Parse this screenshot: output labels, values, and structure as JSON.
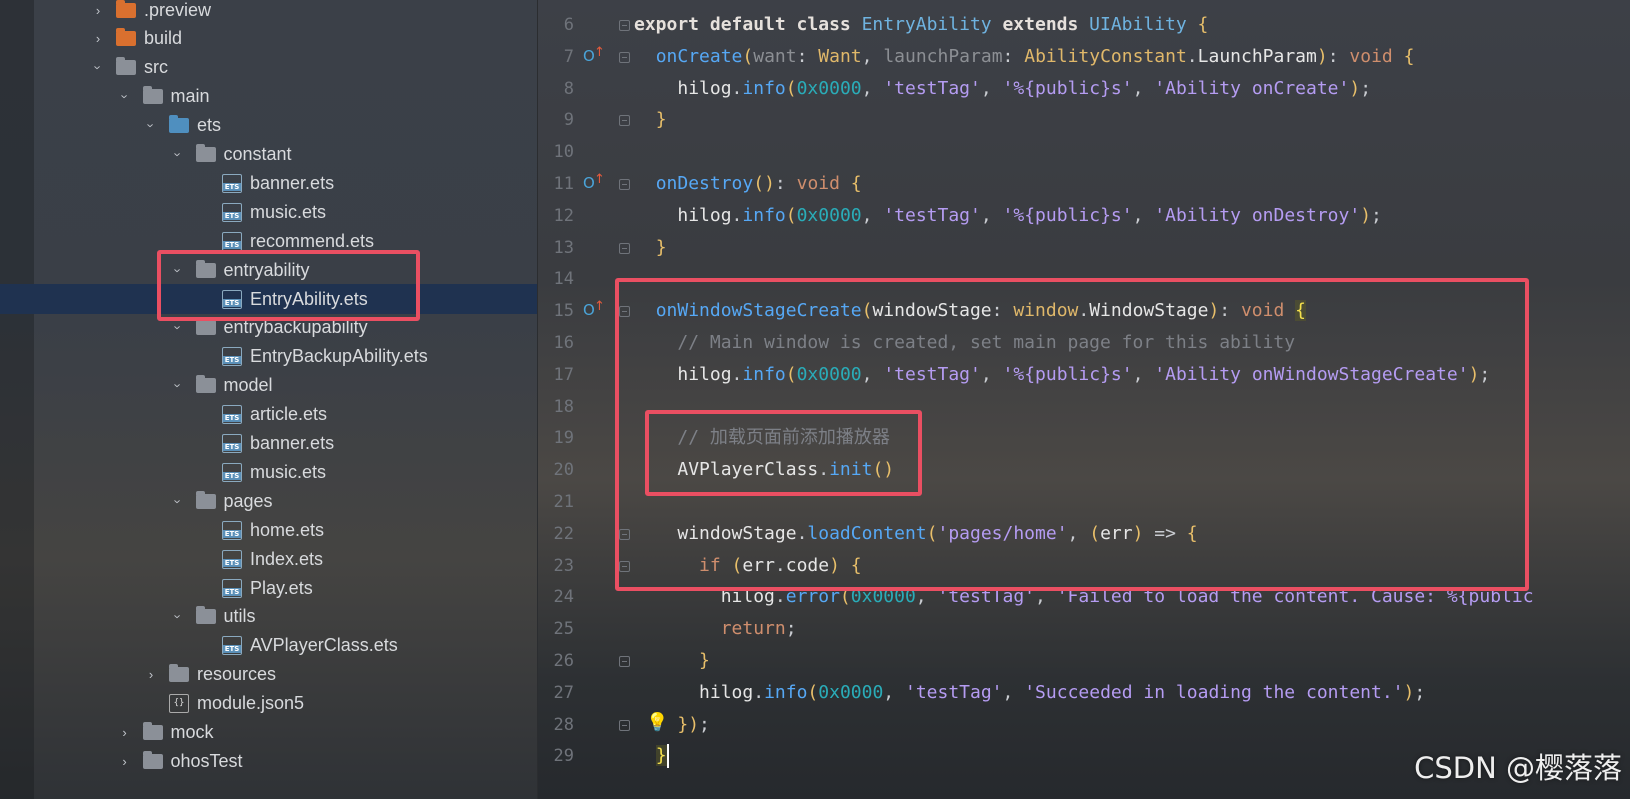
{
  "project_tree": {
    "items": [
      {
        "label": ".preview",
        "depth": 1,
        "type": "folder",
        "color": "orange",
        "expanded": false
      },
      {
        "label": "build",
        "depth": 1,
        "type": "folder",
        "color": "orange",
        "expanded": false
      },
      {
        "label": "src",
        "depth": 1,
        "type": "folder",
        "color": "gray",
        "expanded": true
      },
      {
        "label": "main",
        "depth": 2,
        "type": "folder",
        "color": "gray",
        "expanded": true
      },
      {
        "label": "ets",
        "depth": 3,
        "type": "folder",
        "color": "blue",
        "expanded": true
      },
      {
        "label": "constant",
        "depth": 4,
        "type": "folder",
        "color": "gray",
        "expanded": true
      },
      {
        "label": "banner.ets",
        "depth": 5,
        "type": "file"
      },
      {
        "label": "music.ets",
        "depth": 5,
        "type": "file"
      },
      {
        "label": "recommend.ets",
        "depth": 5,
        "type": "file"
      },
      {
        "label": "entryability",
        "depth": 4,
        "type": "folder",
        "color": "gray",
        "expanded": true
      },
      {
        "label": "EntryAbility.ets",
        "depth": 5,
        "type": "file",
        "selected": true
      },
      {
        "label": "entrybackupability",
        "depth": 4,
        "type": "folder",
        "color": "gray",
        "expanded": true
      },
      {
        "label": "EntryBackupAbility.ets",
        "depth": 5,
        "type": "file"
      },
      {
        "label": "model",
        "depth": 4,
        "type": "folder",
        "color": "gray",
        "expanded": true
      },
      {
        "label": "article.ets",
        "depth": 5,
        "type": "file"
      },
      {
        "label": "banner.ets",
        "depth": 5,
        "type": "file"
      },
      {
        "label": "music.ets",
        "depth": 5,
        "type": "file"
      },
      {
        "label": "pages",
        "depth": 4,
        "type": "folder",
        "color": "gray",
        "expanded": true
      },
      {
        "label": "home.ets",
        "depth": 5,
        "type": "file"
      },
      {
        "label": "Index.ets",
        "depth": 5,
        "type": "file"
      },
      {
        "label": "Play.ets",
        "depth": 5,
        "type": "file"
      },
      {
        "label": "utils",
        "depth": 4,
        "type": "folder",
        "color": "gray",
        "expanded": true
      },
      {
        "label": "AVPlayerClass.ets",
        "depth": 5,
        "type": "file"
      },
      {
        "label": "resources",
        "depth": 3,
        "type": "folder",
        "color": "gray",
        "expanded": false
      },
      {
        "label": "module.json5",
        "depth": 3,
        "type": "json"
      },
      {
        "label": "mock",
        "depth": 2,
        "type": "folder",
        "color": "gray",
        "expanded": false
      },
      {
        "label": "ohosTest",
        "depth": 2,
        "type": "folder",
        "color": "gray",
        "expanded": false
      }
    ],
    "file_badge": "ETS",
    "json_badge": "{}"
  },
  "editor": {
    "lines": [
      {
        "n": "6",
        "fold": true,
        "tokens": [
          [
            "kwb",
            "export default class "
          ],
          [
            "cls",
            "EntryAbility "
          ],
          [
            "kwb",
            "extends "
          ],
          [
            "cls",
            "UIAbility "
          ],
          [
            "brace",
            "{"
          ]
        ]
      },
      {
        "n": "7",
        "fold": true,
        "override": true,
        "tokens": [
          [
            "pun",
            "  "
          ],
          [
            "fn",
            "onCreate"
          ],
          [
            "brace",
            "("
          ],
          [
            "prm",
            "want"
          ],
          [
            "pun",
            ": "
          ],
          [
            "typ",
            "Want"
          ],
          [
            "pun",
            ", "
          ],
          [
            "prm",
            "launchParam"
          ],
          [
            "pun",
            ": "
          ],
          [
            "typ",
            "AbilityConstant"
          ],
          [
            "pun",
            "."
          ],
          [
            "var",
            "LaunchParam"
          ],
          [
            "brace",
            ")"
          ],
          [
            "pun",
            ": "
          ],
          [
            "kw",
            "void "
          ],
          [
            "brace",
            "{"
          ]
        ]
      },
      {
        "n": "8",
        "tokens": [
          [
            "pun",
            "    "
          ],
          [
            "var",
            "hilog"
          ],
          [
            "pun",
            "."
          ],
          [
            "fn",
            "info"
          ],
          [
            "brace",
            "("
          ],
          [
            "num",
            "0x0000"
          ],
          [
            "pun",
            ", "
          ],
          [
            "str2",
            "'testTag'"
          ],
          [
            "pun",
            ", "
          ],
          [
            "str2",
            "'%{public}s'"
          ],
          [
            "pun",
            ", "
          ],
          [
            "str2",
            "'Ability onCreate'"
          ],
          [
            "brace",
            ")"
          ],
          [
            "pun",
            ";"
          ]
        ]
      },
      {
        "n": "9",
        "fold": true,
        "tokens": [
          [
            "pun",
            "  "
          ],
          [
            "brace",
            "}"
          ]
        ]
      },
      {
        "n": "10",
        "tokens": []
      },
      {
        "n": "11",
        "fold": true,
        "override": true,
        "tokens": [
          [
            "pun",
            "  "
          ],
          [
            "fn",
            "onDestroy"
          ],
          [
            "brace",
            "()"
          ],
          [
            "pun",
            ": "
          ],
          [
            "kw",
            "void "
          ],
          [
            "brace",
            "{"
          ]
        ]
      },
      {
        "n": "12",
        "tokens": [
          [
            "pun",
            "    "
          ],
          [
            "var",
            "hilog"
          ],
          [
            "pun",
            "."
          ],
          [
            "fn",
            "info"
          ],
          [
            "brace",
            "("
          ],
          [
            "num",
            "0x0000"
          ],
          [
            "pun",
            ", "
          ],
          [
            "str2",
            "'testTag'"
          ],
          [
            "pun",
            ", "
          ],
          [
            "str2",
            "'%{public}s'"
          ],
          [
            "pun",
            ", "
          ],
          [
            "str2",
            "'Ability onDestroy'"
          ],
          [
            "brace",
            ")"
          ],
          [
            "pun",
            ";"
          ]
        ]
      },
      {
        "n": "13",
        "fold": true,
        "tokens": [
          [
            "pun",
            "  "
          ],
          [
            "brace",
            "}"
          ]
        ]
      },
      {
        "n": "14",
        "tokens": []
      },
      {
        "n": "15",
        "fold": true,
        "override": true,
        "tokens": [
          [
            "pun",
            "  "
          ],
          [
            "fn",
            "onWindowStageCreate"
          ],
          [
            "brace",
            "("
          ],
          [
            "var",
            "windowStage"
          ],
          [
            "pun",
            ": "
          ],
          [
            "typ",
            "window"
          ],
          [
            "pun",
            "."
          ],
          [
            "var",
            "WindowStage"
          ],
          [
            "brace",
            ")"
          ],
          [
            "pun",
            ": "
          ],
          [
            "kw",
            "void "
          ],
          [
            "hlbrace",
            "{"
          ]
        ]
      },
      {
        "n": "16",
        "tokens": [
          [
            "pun",
            "    "
          ],
          [
            "cmt",
            "// Main window is created, set main page for this ability"
          ]
        ]
      },
      {
        "n": "17",
        "tokens": [
          [
            "pun",
            "    "
          ],
          [
            "var",
            "hilog"
          ],
          [
            "pun",
            "."
          ],
          [
            "fn",
            "info"
          ],
          [
            "brace",
            "("
          ],
          [
            "num",
            "0x0000"
          ],
          [
            "pun",
            ", "
          ],
          [
            "str2",
            "'testTag'"
          ],
          [
            "pun",
            ", "
          ],
          [
            "str2",
            "'%{public}s'"
          ],
          [
            "pun",
            ", "
          ],
          [
            "str2",
            "'Ability onWindowStageCreate'"
          ],
          [
            "brace",
            ")"
          ],
          [
            "pun",
            ";"
          ]
        ]
      },
      {
        "n": "18",
        "tokens": []
      },
      {
        "n": "19",
        "tokens": [
          [
            "pun",
            "    "
          ],
          [
            "cmt",
            "// 加载页面前添加播放器"
          ]
        ]
      },
      {
        "n": "20",
        "tokens": [
          [
            "pun",
            "    "
          ],
          [
            "var",
            "AVPlayerClass"
          ],
          [
            "pun",
            "."
          ],
          [
            "fn",
            "init"
          ],
          [
            "brace",
            "()"
          ]
        ]
      },
      {
        "n": "21",
        "tokens": []
      },
      {
        "n": "22",
        "fold": true,
        "tokens": [
          [
            "pun",
            "    "
          ],
          [
            "var",
            "windowStage"
          ],
          [
            "pun",
            "."
          ],
          [
            "fn",
            "loadContent"
          ],
          [
            "brace",
            "("
          ],
          [
            "str2",
            "'pages/home'"
          ],
          [
            "pun",
            ", "
          ],
          [
            "brace",
            "("
          ],
          [
            "var",
            "err"
          ],
          [
            "brace",
            ")"
          ],
          [
            "pun",
            " => "
          ],
          [
            "brace",
            "{"
          ]
        ]
      },
      {
        "n": "23",
        "fold": true,
        "tokens": [
          [
            "pun",
            "      "
          ],
          [
            "kw",
            "if "
          ],
          [
            "brace",
            "("
          ],
          [
            "var",
            "err"
          ],
          [
            "pun",
            "."
          ],
          [
            "var",
            "code"
          ],
          [
            "brace",
            ") "
          ],
          [
            "brace",
            "{"
          ]
        ]
      },
      {
        "n": "24",
        "tokens": [
          [
            "pun",
            "        "
          ],
          [
            "var",
            "hilog"
          ],
          [
            "pun",
            "."
          ],
          [
            "fn",
            "error"
          ],
          [
            "brace",
            "("
          ],
          [
            "num",
            "0x0000"
          ],
          [
            "pun",
            ", "
          ],
          [
            "str2",
            "'testTag'"
          ],
          [
            "pun",
            ", "
          ],
          [
            "str2",
            "'Failed to load the content. Cause: %{public"
          ]
        ]
      },
      {
        "n": "25",
        "tokens": [
          [
            "pun",
            "        "
          ],
          [
            "kw",
            "return"
          ],
          [
            "pun",
            ";"
          ]
        ]
      },
      {
        "n": "26",
        "fold": true,
        "tokens": [
          [
            "pun",
            "      "
          ],
          [
            "brace",
            "}"
          ]
        ]
      },
      {
        "n": "27",
        "tokens": [
          [
            "pun",
            "      "
          ],
          [
            "var",
            "hilog"
          ],
          [
            "pun",
            "."
          ],
          [
            "fn",
            "info"
          ],
          [
            "brace",
            "("
          ],
          [
            "num",
            "0x0000"
          ],
          [
            "pun",
            ", "
          ],
          [
            "str2",
            "'testTag'"
          ],
          [
            "pun",
            ", "
          ],
          [
            "str2",
            "'Succeeded in loading the content.'"
          ],
          [
            "brace",
            ")"
          ],
          [
            "pun",
            ";"
          ]
        ]
      },
      {
        "n": "28",
        "fold": true,
        "bulb": true,
        "tokens": [
          [
            "pun",
            "    "
          ],
          [
            "brace",
            "})"
          ],
          [
            "pun",
            ";"
          ]
        ]
      },
      {
        "n": "29",
        "caret": true,
        "tokens": [
          [
            "pun",
            "  "
          ],
          [
            "hlbrace",
            "}"
          ]
        ]
      }
    ],
    "override_glyph": "O",
    "override_arrow": "↑",
    "bulb_glyph": "💡"
  },
  "watermark": "CSDN @樱落落",
  "colors": {
    "highlight_box": "#ea4f62",
    "selection": "#1f3250"
  }
}
